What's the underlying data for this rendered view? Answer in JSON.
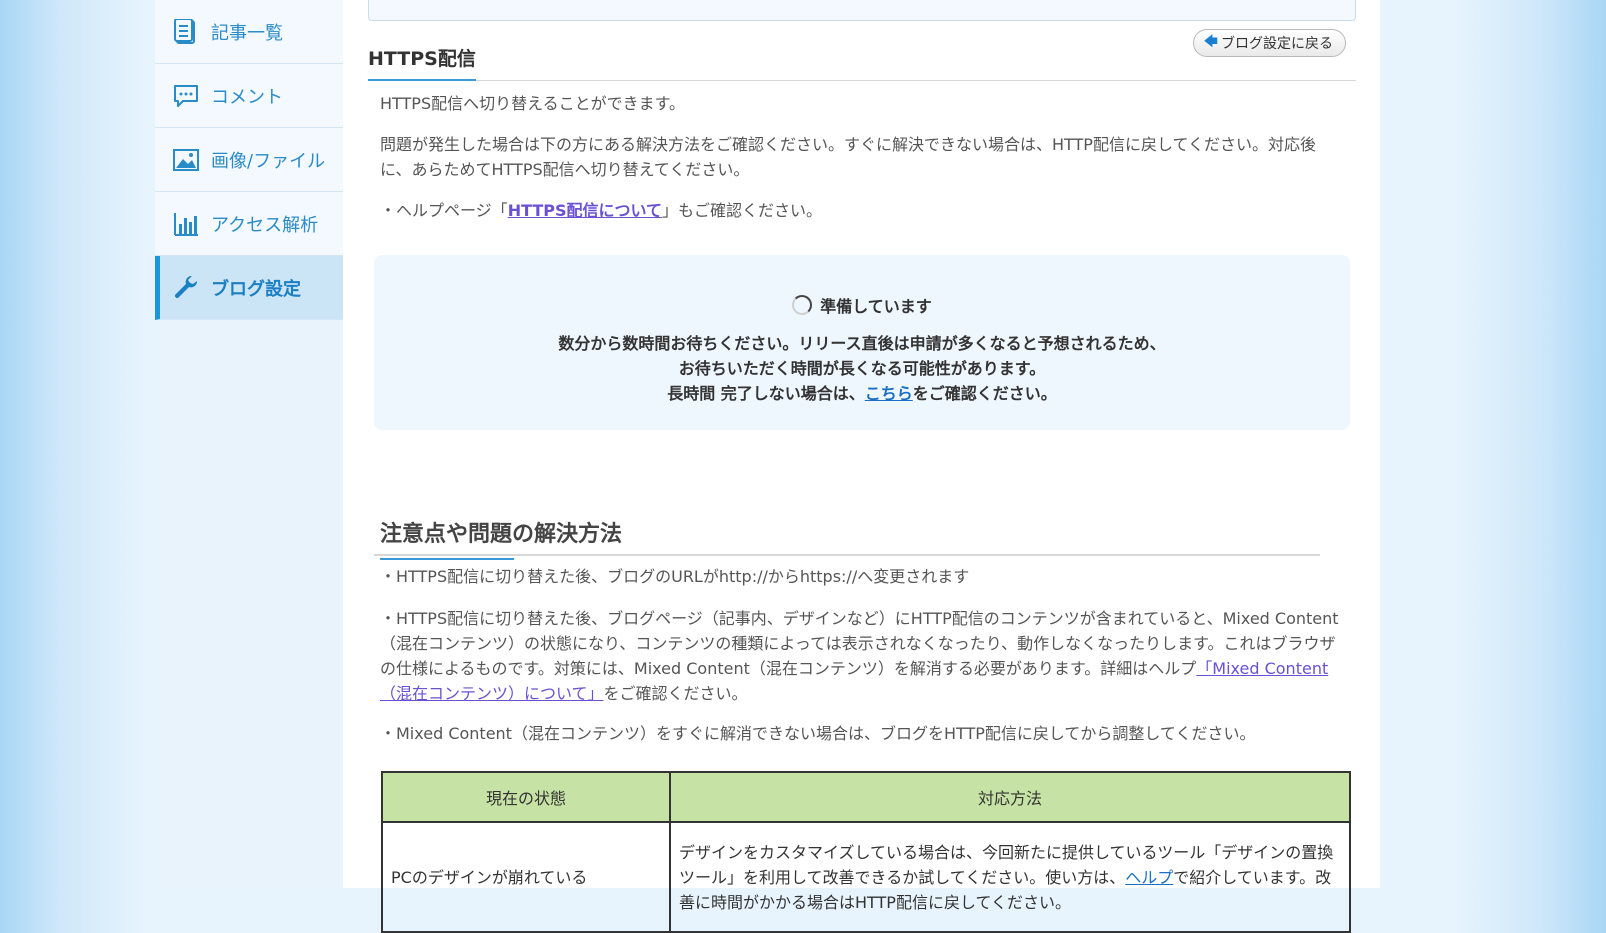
{
  "sidebar": {
    "items": [
      {
        "label": "記事一覧",
        "icon": "article-list-icon"
      },
      {
        "label": "コメント",
        "icon": "comment-icon"
      },
      {
        "label": "画像/ファイル",
        "icon": "image-icon"
      },
      {
        "label": "アクセス解析",
        "icon": "bar-chart-icon"
      },
      {
        "label": "ブログ設定",
        "icon": "wrench-icon",
        "active": true
      }
    ]
  },
  "page": {
    "title": "HTTPS配信",
    "back_button": "ブログ設定に戻る"
  },
  "intro": {
    "p1": "HTTPS配信へ切り替えることができます。",
    "p2": "問題が発生した場合は下の方にある解決方法をご確認ください。すぐに解決できない場合は、HTTP配信に戻してください。対応後に、あらためてHTTPS配信へ切り替えてください。",
    "p3_pre": "・ヘルプページ「",
    "p3_link": "HTTPS配信について",
    "p3_post": "」もご確認ください。"
  },
  "status": {
    "title": "準備しています",
    "line1": "数分から数時間お待ちください。リリース直後は申請が多くなると予想されるため、",
    "line2": "お待ちいただく時間が長くなる可能性があります。",
    "line3_pre": "長時間 完了しない場合は、",
    "line3_link": "こちら",
    "line3_post": "をご確認ください。"
  },
  "notes": {
    "title": "注意点や問題の解決方法",
    "n1": "・HTTPS配信に切り替えた後、ブログのURLがhttp://からhttps://へ変更されます",
    "n2_pre": "・HTTPS配信に切り替えた後、ブログページ（記事内、デザインなど）にHTTP配信のコンテンツが含まれていると、Mixed Content（混在コンテンツ）の状態になり、コンテンツの種類によっては表示されなくなったり、動作しなくなったりします。これはブラウザの仕様によるものです。対策には、Mixed Content（混在コンテンツ）を解消する必要があります。詳細はヘルプ",
    "n2_link": "「Mixed Content（混在コンテンツ）について」",
    "n2_post": "をご確認ください。",
    "n3": "・Mixed Content（混在コンテンツ）をすぐに解消できない場合は、ブログをHTTP配信に戻してから調整してください。"
  },
  "table": {
    "headers": [
      "現在の状態",
      "対応方法"
    ],
    "row1": {
      "state": "PCのデザインが崩れている",
      "method_pre": "デザインをカスタマイズしている場合は、今回新たに提供しているツール「デザインの置換ツール」を利用して改善できるか試してください。使い方は、",
      "method_link": "ヘルプ",
      "method_post": "で紹介しています。改善に時間がかかる場合はHTTP配信に戻してください。"
    }
  }
}
